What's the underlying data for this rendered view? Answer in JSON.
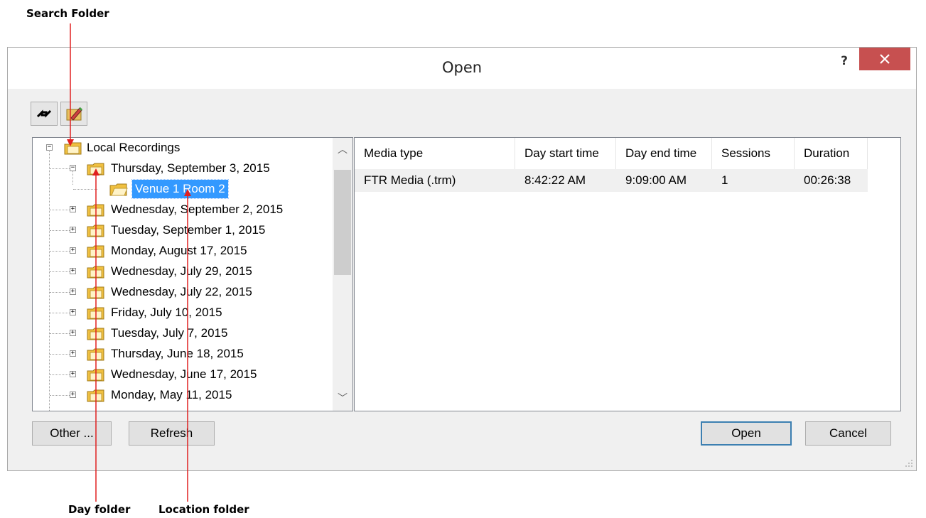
{
  "callouts": {
    "search_folder": "Search Folder",
    "day_folder": "Day folder",
    "location_folder": "Location folder"
  },
  "window": {
    "title": "Open",
    "help": "?"
  },
  "toolbar": {
    "up_icon": "refresh-folder-icon",
    "new_icon": "edit-folder-icon"
  },
  "tree": {
    "root": "Local Recordings",
    "items": [
      {
        "label": "Thursday, September 3, 2015",
        "expanded": true
      },
      {
        "label": "Venue 1 Room 2",
        "selected": true
      },
      {
        "label": "Wednesday, September 2, 2015"
      },
      {
        "label": "Tuesday, September 1, 2015"
      },
      {
        "label": "Monday, August 17, 2015"
      },
      {
        "label": "Wednesday, July 29, 2015"
      },
      {
        "label": "Wednesday, July 22, 2015"
      },
      {
        "label": "Friday, July 10, 2015"
      },
      {
        "label": "Tuesday, July 7, 2015"
      },
      {
        "label": "Thursday, June 18, 2015"
      },
      {
        "label": "Wednesday, June 17, 2015"
      },
      {
        "label": "Monday, May 11, 2015"
      }
    ]
  },
  "list": {
    "columns": [
      "Media type",
      "Day start time",
      "Day end time",
      "Sessions",
      "Duration"
    ],
    "rows": [
      [
        "FTR Media (.trm)",
        "8:42:22 AM",
        "9:09:00 AM",
        "1",
        "00:26:38"
      ]
    ]
  },
  "buttons": {
    "other": "Other ...",
    "refresh": "Refresh",
    "open": "Open",
    "cancel": "Cancel"
  },
  "colors": {
    "selection": "#3399ff",
    "close_button": "#c75050",
    "callout_arrow": "#e02020"
  }
}
